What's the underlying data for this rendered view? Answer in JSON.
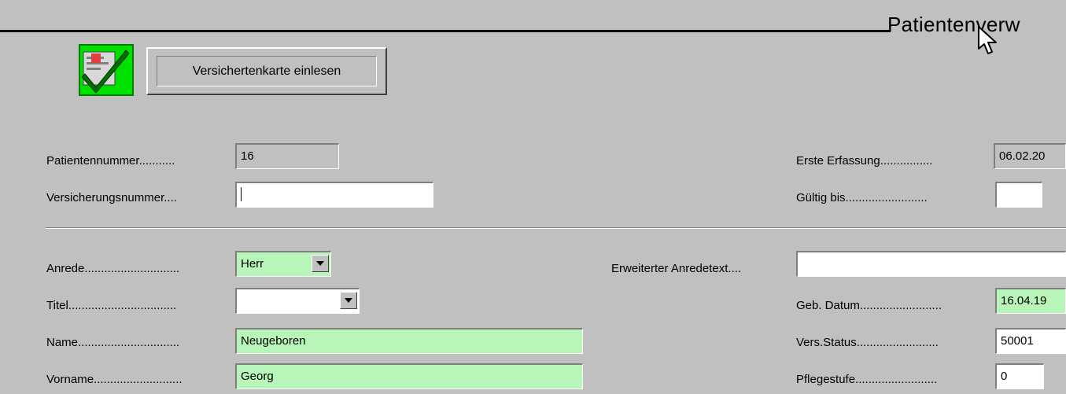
{
  "header": {
    "title": "Patientenverw",
    "read_card_button": "Versichertenkarte einlesen",
    "confirm_icon": "green-checkmark-icon"
  },
  "fields": {
    "patientennummer": {
      "label": "Patientennummer...........",
      "value": "16"
    },
    "versicherungsnummer": {
      "label": "Versicherungsnummer....",
      "value": ""
    },
    "erste_erfassung": {
      "label": "Erste Erfassung................",
      "value": "06.02.20"
    },
    "gueltig_bis": {
      "label": "Gültig bis.........................",
      "value": ""
    },
    "anrede": {
      "label": "Anrede.............................",
      "value": "Herr"
    },
    "erweiterter_anredetext": {
      "label": "Erweiterter Anredetext....",
      "value": ""
    },
    "titel": {
      "label": "Titel.................................",
      "value": ""
    },
    "geb_datum": {
      "label": "Geb. Datum.........................",
      "value": "16.04.19"
    },
    "name": {
      "label": "Name...............................",
      "value": "Neugeboren"
    },
    "vers_status": {
      "label": "Vers.Status.........................",
      "value": "50001"
    },
    "vorname": {
      "label": "Vorname...........................",
      "value": "Georg"
    },
    "pflegestufe": {
      "label": "Pflegestufe.........................",
      "value": "0"
    }
  },
  "colors": {
    "background": "#c0c0c0",
    "mandatory_field": "#b8f5b8",
    "icon_green": "#00e000"
  }
}
